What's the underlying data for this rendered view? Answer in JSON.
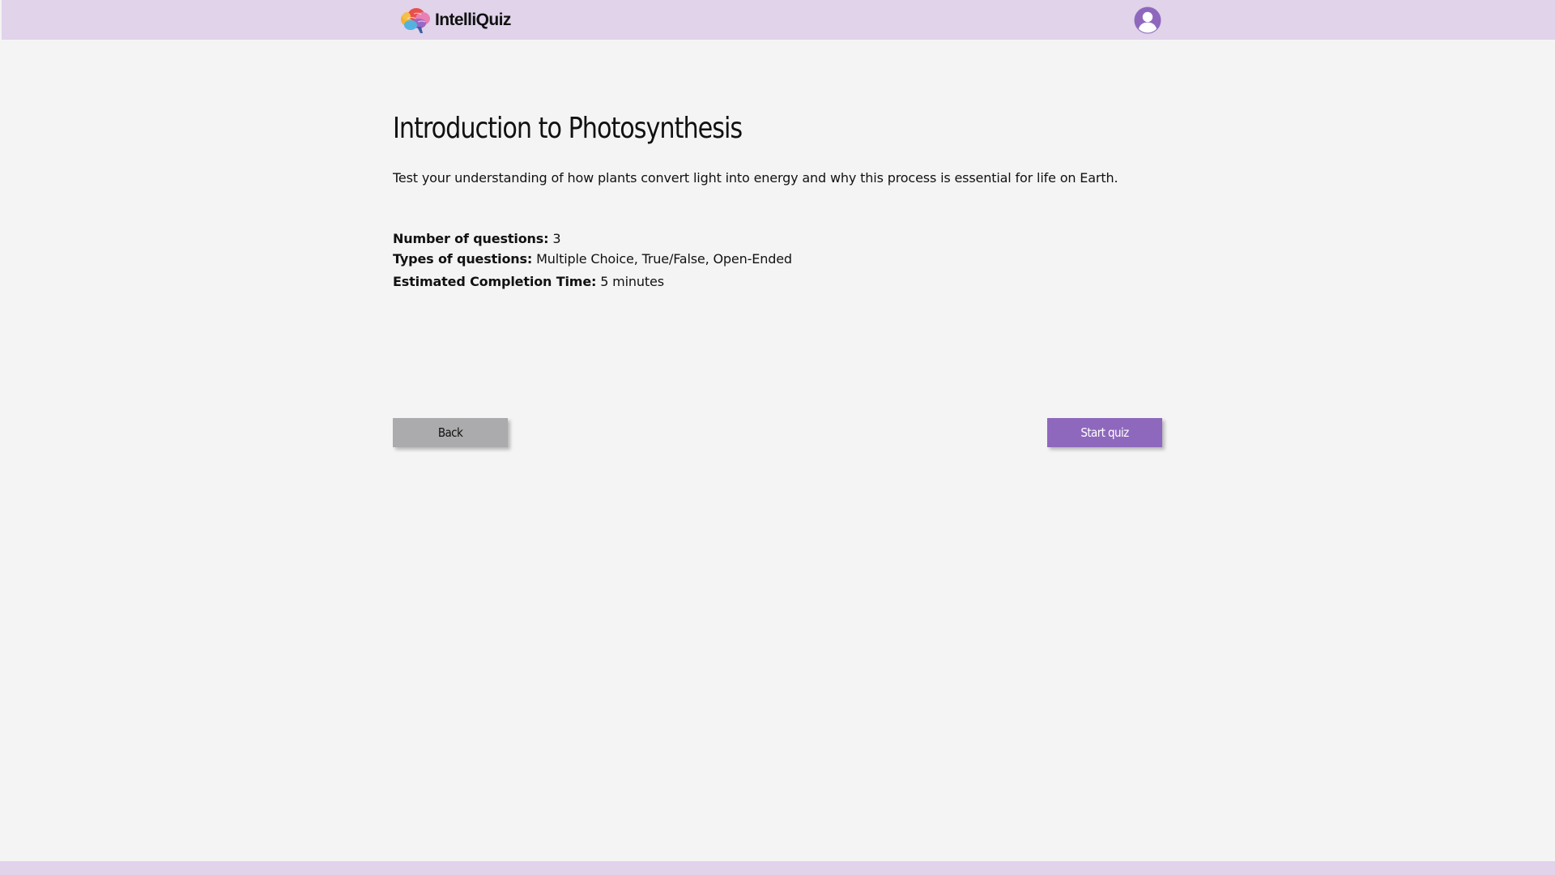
{
  "header": {
    "app_name": "IntelliQuiz",
    "logo_icon": "brain-icon",
    "profile_icon": "user-avatar-icon"
  },
  "quiz": {
    "title": "Introduction to Photosynthesis",
    "description": "Test your understanding of how plants convert light into energy and why this process is essential for life on Earth.",
    "details": [
      {
        "label": "Number of questions:",
        "value": "3"
      },
      {
        "label": "Types of questions:",
        "value": "Multiple Choice, True/False, Open-Ended"
      },
      {
        "label": "Estimated Completion Time:",
        "value": "5 minutes"
      }
    ]
  },
  "actions": {
    "back_label": "Back",
    "start_label": "Start quiz"
  },
  "colors": {
    "header_bg": "#e0d3ea",
    "page_bg": "#f4f4f4",
    "accent": "#8e68bd",
    "back_button_bg": "#ababad"
  }
}
